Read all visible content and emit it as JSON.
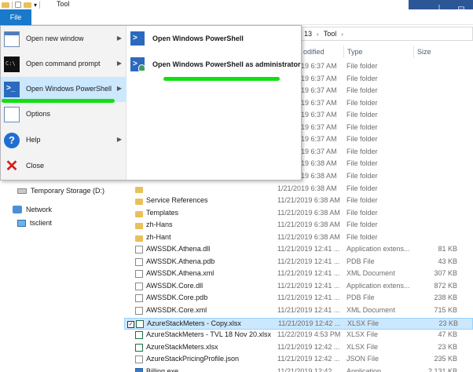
{
  "window": {
    "title": "Tool",
    "buttons": {
      "minimize": "▁",
      "pin": "⊥",
      "maximize": "▭"
    }
  },
  "ribbon": {
    "file_tab": "File"
  },
  "address": {
    "parts": [
      "13",
      "Tool"
    ]
  },
  "columns": {
    "modified": "odified",
    "type": "Type",
    "size": "Size"
  },
  "file_menu": {
    "left_items": [
      {
        "label": "Open new window",
        "icon": "window-icon",
        "has_submenu": true
      },
      {
        "label": "Open command prompt",
        "icon": "cmd-icon",
        "has_submenu": true
      },
      {
        "label": "Open Windows PowerShell",
        "icon": "powershell-icon",
        "has_submenu": true
      },
      {
        "label": "Options",
        "icon": "options-icon",
        "has_submenu": false
      },
      {
        "label": "Help",
        "icon": "help-icon",
        "has_submenu": true
      },
      {
        "label": "Close",
        "icon": "close-icon",
        "has_submenu": false
      }
    ],
    "submenu": [
      {
        "label": "Open Windows PowerShell",
        "icon": "powershell-icon"
      },
      {
        "label": "Open Windows PowerShell as administrator",
        "icon": "powershell-admin-icon"
      }
    ],
    "chevron": "▶"
  },
  "nav_pane": {
    "items": [
      {
        "label": "Temporary Storage (D:)",
        "icon": "drive-icon"
      },
      {
        "label": "Network",
        "icon": "network-icon"
      },
      {
        "label": "tsclient",
        "icon": "computer-icon"
      }
    ]
  },
  "file_list": {
    "rows": [
      {
        "name": "",
        "date": "1/21/2019 6:37 AM",
        "type": "File folder",
        "size": "",
        "kind": "folder"
      },
      {
        "name": "",
        "date": "1/21/2019 6:37 AM",
        "type": "File folder",
        "size": "",
        "kind": "folder"
      },
      {
        "name": "",
        "date": "1/21/2019 6:37 AM",
        "type": "File folder",
        "size": "",
        "kind": "folder"
      },
      {
        "name": "",
        "date": "1/21/2019 6:37 AM",
        "type": "File folder",
        "size": "",
        "kind": "folder"
      },
      {
        "name": "",
        "date": "1/21/2019 6:37 AM",
        "type": "File folder",
        "size": "",
        "kind": "folder"
      },
      {
        "name": "",
        "date": "1/21/2019 6:37 AM",
        "type": "File folder",
        "size": "",
        "kind": "folder"
      },
      {
        "name": "",
        "date": "1/21/2019 6:37 AM",
        "type": "File folder",
        "size": "",
        "kind": "folder"
      },
      {
        "name": "",
        "date": "1/21/2019 6:37 AM",
        "type": "File folder",
        "size": "",
        "kind": "folder"
      },
      {
        "name": "",
        "date": "1/21/2019 6:38 AM",
        "type": "File folder",
        "size": "",
        "kind": "folder"
      },
      {
        "name": "",
        "date": "1/21/2019 6:38 AM",
        "type": "File folder",
        "size": "",
        "kind": "folder"
      },
      {
        "name": "",
        "date": "1/21/2019 6:38 AM",
        "type": "File folder",
        "size": "",
        "kind": "folder"
      },
      {
        "name": "Service References",
        "date": "11/21/2019 6:38 AM",
        "type": "File folder",
        "size": "",
        "kind": "folder"
      },
      {
        "name": "Templates",
        "date": "11/21/2019 6:38 AM",
        "type": "File folder",
        "size": "",
        "kind": "folder"
      },
      {
        "name": "zh-Hans",
        "date": "11/21/2019 6:38 AM",
        "type": "File folder",
        "size": "",
        "kind": "folder"
      },
      {
        "name": "zh-Hant",
        "date": "11/21/2019 6:38 AM",
        "type": "File folder",
        "size": "",
        "kind": "folder"
      },
      {
        "name": "AWSSDK.Athena.dll",
        "date": "11/21/2019 12:41 ...",
        "type": "Application extens...",
        "size": "81 KB",
        "kind": "doc"
      },
      {
        "name": "AWSSDK.Athena.pdb",
        "date": "11/21/2019 12:41 ...",
        "type": "PDB File",
        "size": "43 KB",
        "kind": "doc"
      },
      {
        "name": "AWSSDK.Athena.xml",
        "date": "11/21/2019 12:41 ...",
        "type": "XML Document",
        "size": "307 KB",
        "kind": "doc"
      },
      {
        "name": "AWSSDK.Core.dll",
        "date": "11/21/2019 12:41 ...",
        "type": "Application extens...",
        "size": "872 KB",
        "kind": "doc"
      },
      {
        "name": "AWSSDK.Core.pdb",
        "date": "11/21/2019 12:41 ...",
        "type": "PDB File",
        "size": "238 KB",
        "kind": "doc"
      },
      {
        "name": "AWSSDK.Core.xml",
        "date": "11/21/2019 12:41 ...",
        "type": "XML Document",
        "size": "715 KB",
        "kind": "doc"
      },
      {
        "name": "AzureStackMeters - Copy.xlsx",
        "date": "11/21/2019 12:42 ...",
        "type": "XLSX File",
        "size": "23 KB",
        "kind": "xlsx",
        "selected": true
      },
      {
        "name": "AzureStackMeters - TVL 18 Nov 20.xlsx",
        "date": "11/22/2019 4:53 PM",
        "type": "XLSX File",
        "size": "47 KB",
        "kind": "xlsx"
      },
      {
        "name": "AzureStackMeters.xlsx",
        "date": "11/21/2019 12:42 ...",
        "type": "XLSX File",
        "size": "23 KB",
        "kind": "xlsx"
      },
      {
        "name": "AzureStackPricingProfile.json",
        "date": "11/21/2019 12:42 ...",
        "type": "JSON File",
        "size": "235 KB",
        "kind": "doc"
      },
      {
        "name": "Billing.exe",
        "date": "11/21/2019 12:42 ...",
        "type": "Application",
        "size": "2,131 KB",
        "kind": "exe"
      }
    ]
  },
  "colors": {
    "accent": "#1979ca",
    "selection": "#cce8ff",
    "highlight_stroke": "#12e012",
    "titlebar_buttons": "#2b5797"
  }
}
